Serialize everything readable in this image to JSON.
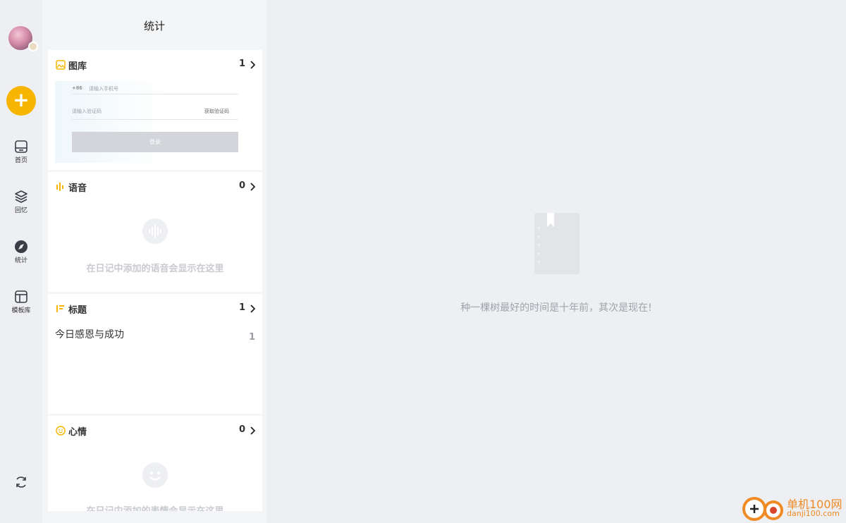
{
  "nav": {
    "items": [
      {
        "label": "首页",
        "icon": "home-icon"
      },
      {
        "label": "回忆",
        "icon": "layers-icon"
      },
      {
        "label": "统计",
        "icon": "compass-icon"
      },
      {
        "label": "模板库",
        "icon": "template-icon"
      }
    ],
    "add_label": "+"
  },
  "panel": {
    "title": "统计",
    "gallery": {
      "title": "图库",
      "count": "1",
      "thumb": {
        "country_code": "+86",
        "phone_placeholder": "请输入手机号",
        "code_placeholder": "请输入验证码",
        "get_code": "获取验证码",
        "login": "登录"
      }
    },
    "voice": {
      "title": "语音",
      "count": "0",
      "empty": "在日记中添加的语音会显示在这里"
    },
    "headings": {
      "title": "标题",
      "count": "1",
      "items": [
        {
          "label": "今日感恩与成功",
          "count": "1"
        }
      ]
    },
    "mood": {
      "title": "心情",
      "count": "0",
      "empty": "在日记中添加的表情会显示在这里"
    }
  },
  "main": {
    "empty_text": "种一棵树最好的时间是十年前，其次是现在!"
  },
  "watermark": {
    "cn": "单机100网",
    "en": "danji100.com"
  },
  "colors": {
    "accent": "#f7b500",
    "muted": "#c9cbd0"
  }
}
